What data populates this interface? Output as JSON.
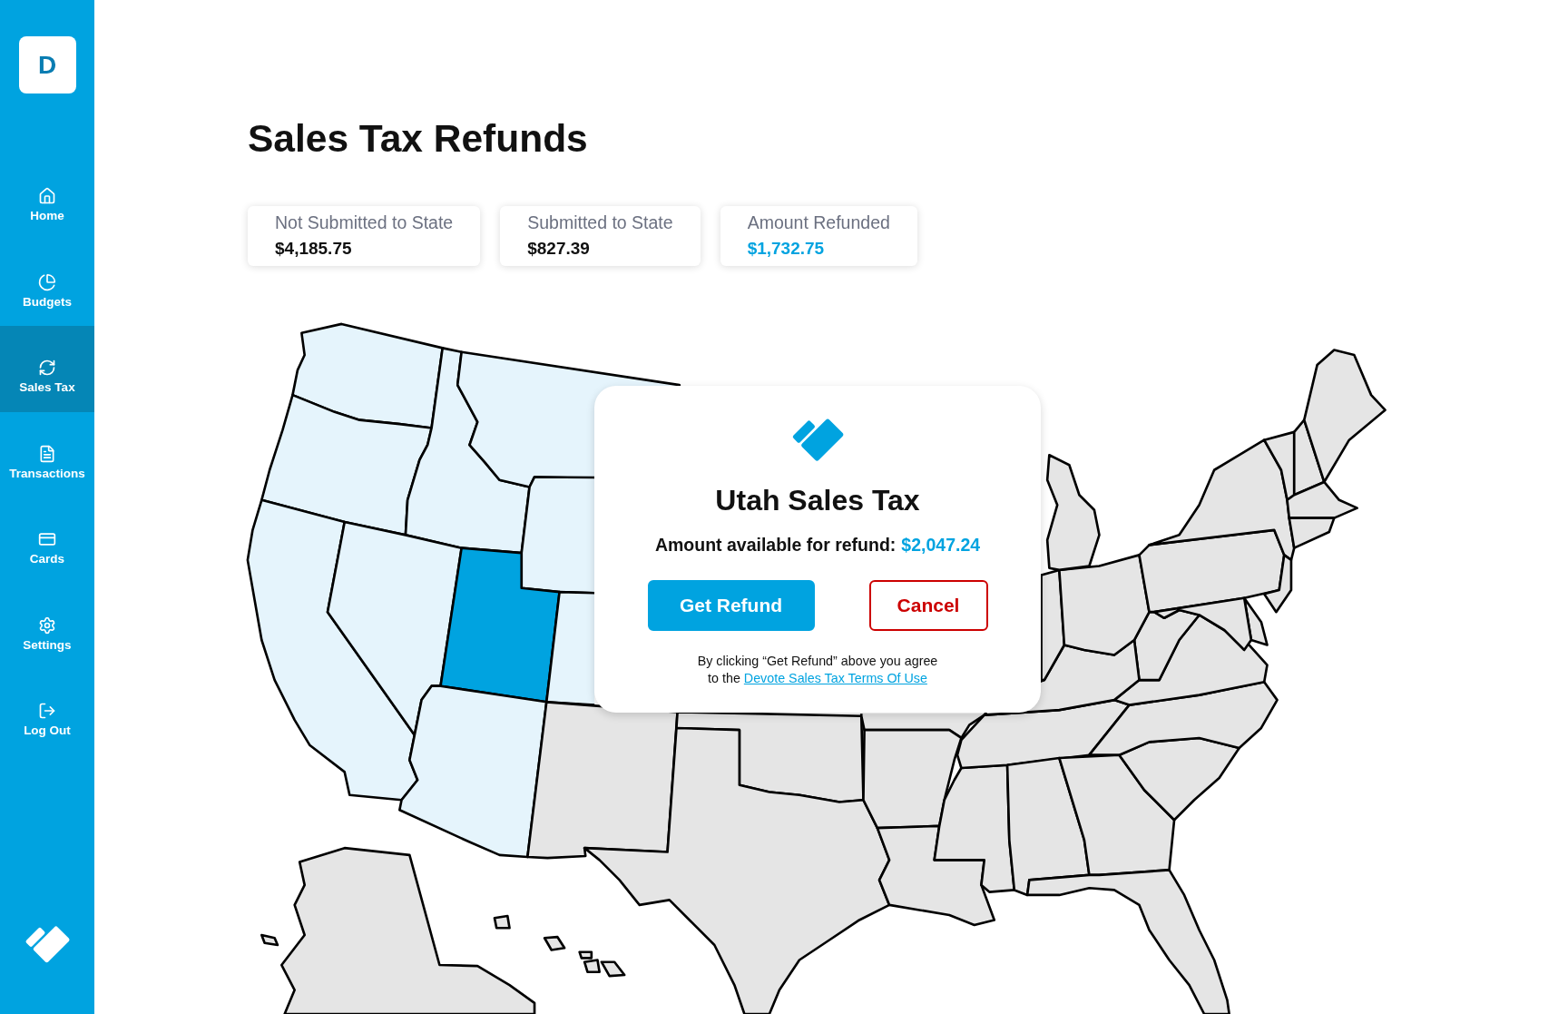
{
  "sidebar": {
    "logo": "D",
    "items": [
      {
        "label": "Home",
        "selected": false
      },
      {
        "label": "Budgets",
        "selected": false
      },
      {
        "label": "Sales Tax",
        "selected": true
      },
      {
        "label": "Transactions",
        "selected": false
      },
      {
        "label": "Cards",
        "selected": false
      },
      {
        "label": "Settings",
        "selected": false
      },
      {
        "label": "Log Out",
        "selected": false
      }
    ]
  },
  "page": {
    "title": "Sales Tax Refunds"
  },
  "summary_cards": [
    {
      "label": "Not Submitted to State",
      "value": "$4,185.75",
      "color": "#111111"
    },
    {
      "label": "Submitted to State",
      "value": "$827.39",
      "color": "#111111"
    },
    {
      "label": "Amount Refunded",
      "value": "$1,732.75",
      "color": "#00a3e0"
    }
  ],
  "map": {
    "states": [
      {
        "highlighted": true,
        "selected": false
      },
      {
        "highlighted": true,
        "selected": false
      },
      {
        "highlighted": true,
        "selected": false
      },
      {
        "highlighted": true,
        "selected": false
      },
      {
        "highlighted": true,
        "selected": false
      },
      {
        "highlighted": true,
        "selected": false
      },
      {
        "highlighted": true,
        "selected": false
      },
      {
        "highlighted": true,
        "selected": true
      },
      {
        "highlighted": true,
        "selected": false
      },
      {
        "highlighted": true,
        "selected": false
      },
      {
        "highlighted": false,
        "selected": false
      },
      {
        "highlighted": false,
        "selected": false
      },
      {
        "highlighted": false,
        "selected": false
      },
      {
        "highlighted": false,
        "selected": false
      },
      {
        "highlighted": false,
        "selected": false
      },
      {
        "highlighted": false,
        "selected": false
      },
      {
        "highlighted": false,
        "selected": false
      },
      {
        "highlighted": false,
        "selected": false
      },
      {
        "highlighted": false,
        "selected": false
      },
      {
        "highlighted": false,
        "selected": false
      },
      {
        "highlighted": false,
        "selected": false
      },
      {
        "highlighted": false,
        "selected": false
      },
      {
        "highlighted": false,
        "selected": false
      },
      {
        "highlighted": false,
        "selected": false
      },
      {
        "highlighted": false,
        "selected": false
      },
      {
        "highlighted": false,
        "selected": false
      },
      {
        "highlighted": false,
        "selected": false
      },
      {
        "highlighted": false,
        "selected": false
      },
      {
        "highlighted": false,
        "selected": false
      },
      {
        "highlighted": false,
        "selected": false
      },
      {
        "highlighted": false,
        "selected": false
      },
      {
        "highlighted": false,
        "selected": false
      },
      {
        "highlighted": false,
        "selected": false
      },
      {
        "highlighted": false,
        "selected": false
      },
      {
        "highlighted": false,
        "selected": false
      },
      {
        "highlighted": false,
        "selected": false
      },
      {
        "highlighted": false,
        "selected": false
      },
      {
        "highlighted": false,
        "selected": false
      },
      {
        "highlighted": false,
        "selected": false
      },
      {
        "highlighted": false,
        "selected": false
      },
      {
        "highlighted": false,
        "selected": false
      }
    ]
  },
  "modal": {
    "title": "Utah Sales Tax",
    "amount_label": "Amount available for refund:",
    "amount": "$2,047.24",
    "buttons": [
      {
        "label": "Get Refund",
        "kind": "primary"
      },
      {
        "label": "Cancel",
        "kind": "danger"
      }
    ],
    "terms": [
      "By clicking “Get Refund” above you agree",
      "to the"
    ],
    "terms_link": "Devote Sales Tax Terms Of Use"
  }
}
